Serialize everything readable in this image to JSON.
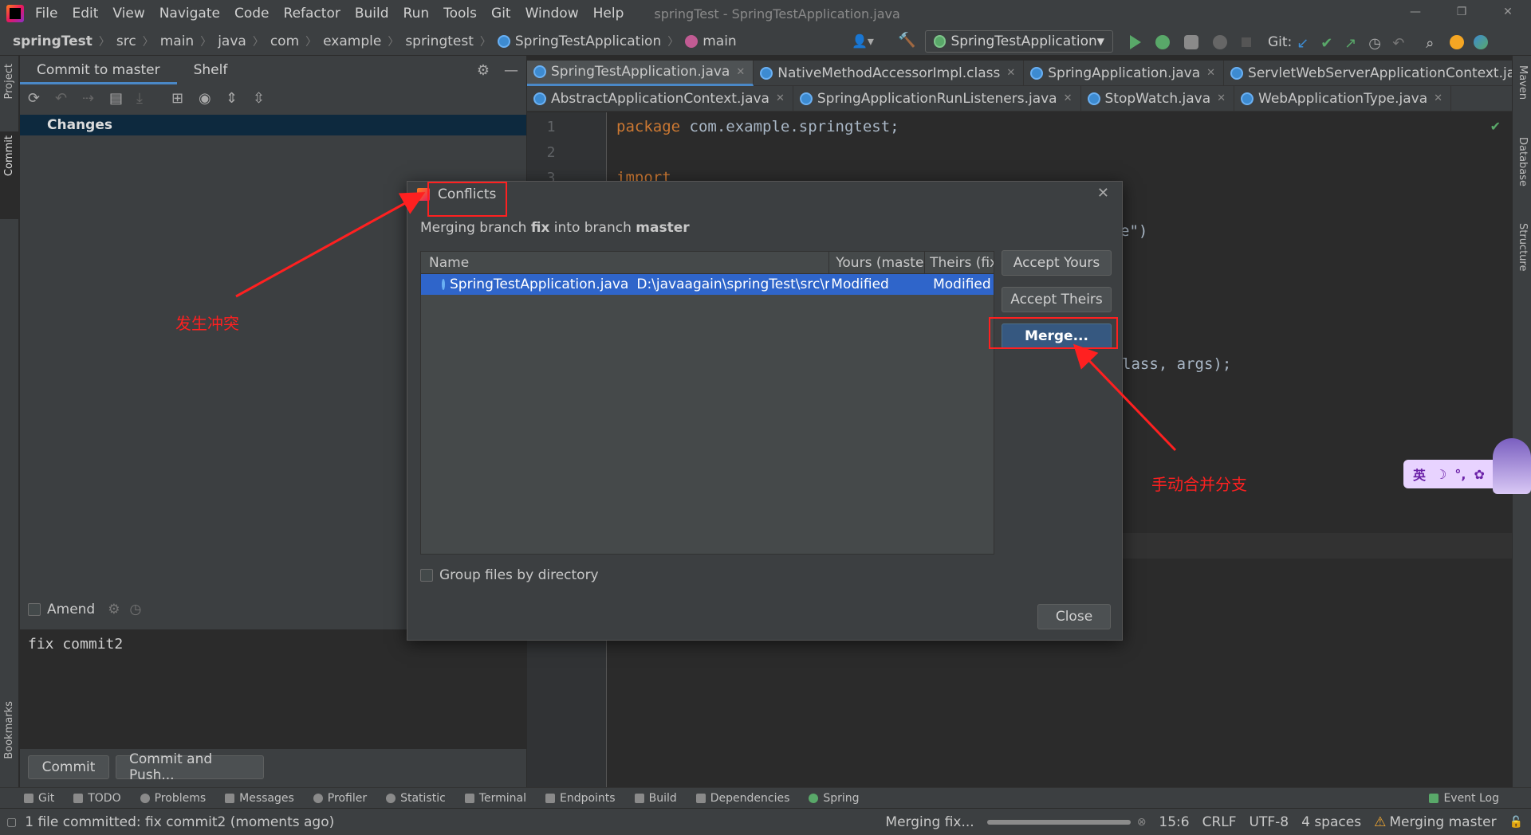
{
  "app": {
    "menu": [
      "File",
      "Edit",
      "View",
      "Navigate",
      "Code",
      "Refactor",
      "Build",
      "Run",
      "Tools",
      "Git",
      "Window",
      "Help"
    ],
    "window_title": "springTest - SpringTestApplication.java"
  },
  "navbar": {
    "crumbs": [
      "springTest",
      "src",
      "main",
      "java",
      "com",
      "example",
      "springtest",
      "SpringTestApplication",
      "main"
    ],
    "run_config": "SpringTestApplication",
    "git_label": "Git:"
  },
  "commit_panel": {
    "tabs": [
      "Commit to master",
      "Shelf"
    ],
    "changes_label": "Changes",
    "amend_label": "Amend",
    "message": "fix commit2",
    "commit_button": "Commit",
    "commit_push_button": "Commit and Push..."
  },
  "left_strip": {
    "project": "Project",
    "commit": "Commit",
    "bookmarks": "Bookmarks"
  },
  "right_strip": {
    "maven": "Maven",
    "database": "Database",
    "structure": "Structure"
  },
  "editor": {
    "tabs_row1": [
      "SpringTestApplication.java",
      "NativeMethodAccessorImpl.class",
      "SpringApplication.java",
      "ServletWebServerApplicationContext.java"
    ],
    "tabs_row2": [
      "AbstractApplicationContext.java",
      "SpringApplicationRunListeners.java",
      "StopWatch.java",
      "WebApplicationType.java"
    ],
    "line_numbers": [
      "1",
      "2",
      "3"
    ],
    "code_line1_kw": "package",
    "code_line1_rest": " com.example.springtest;",
    "code_line3_kw": "import",
    "code_frag1": "e\")",
    "code_frag2": "lass, args);"
  },
  "dialog": {
    "title": "Conflicts",
    "sub_prefix": "Merging branch ",
    "sub_branch_from": "fix",
    "sub_mid": " into branch ",
    "sub_branch_to": "master",
    "columns": [
      "Name",
      "Yours (master)",
      "Theirs (fix)"
    ],
    "row": {
      "file": "SpringTestApplication.java",
      "path": "D:\\javaagain\\springTest\\src\\main",
      "yours": "Modified",
      "theirs": "Modified"
    },
    "accept_yours": "Accept Yours",
    "accept_theirs": "Accept Theirs",
    "merge": "Merge...",
    "group_label": "Group files by directory",
    "close": "Close"
  },
  "annotations": {
    "conflict_note": "发生冲突",
    "merge_note": "手动合并分支"
  },
  "ime": {
    "lang": "英"
  },
  "bottom_tools": [
    "Git",
    "TODO",
    "Problems",
    "Messages",
    "Profiler",
    "Statistic",
    "Terminal",
    "Endpoints",
    "Build",
    "Dependencies",
    "Spring"
  ],
  "event_log": "Event Log",
  "status": {
    "message": "1 file committed: fix commit2 (moments ago)",
    "progress": "Merging fix...",
    "position": "15:6",
    "line_sep": "CRLF",
    "encoding": "UTF-8",
    "indent": "4 spaces",
    "branch": "Merging master"
  }
}
